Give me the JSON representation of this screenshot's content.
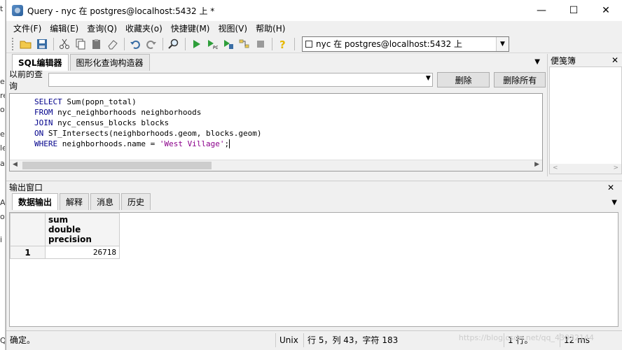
{
  "window": {
    "title": "Query - nyc 在  postgres@localhost:5432 上 *",
    "controls": {
      "minimize": "—",
      "maximize": "☐",
      "close": "✕"
    }
  },
  "menubar": [
    "文件(F)",
    "编辑(E)",
    "查询(Q)",
    "收藏夹(o)",
    "快捷键(M)",
    "视图(V)",
    "帮助(H)"
  ],
  "toolbar": {
    "connection": "nyc 在  postgres@localhost:5432 上"
  },
  "sql_panel": {
    "tabs": [
      "SQL编辑器",
      "图形化查询构造器"
    ],
    "history_label": "以前的查询",
    "delete_button": "删除",
    "delete_all_button": "删除所有",
    "code": {
      "l1a": "SELECT",
      "l1b": " Sum(popn_total)",
      "l2a": "FROM",
      "l2b": " nyc_neighborhoods neighborhoods",
      "l3a": "JOIN",
      "l3b": " nyc_census_blocks blocks",
      "l4a": "ON",
      "l4b": " ST_Intersects(neighborhoods.geom, blocks.geom)",
      "l5a": "WHERE",
      "l5b": " neighborhoods.name = ",
      "l5c": "'West Village'",
      "l5d": ";"
    }
  },
  "notes_panel": {
    "title": "便笺簿",
    "close": "✕"
  },
  "output_panel": {
    "title": "输出窗口",
    "close": "✕",
    "tabs": [
      "数据输出",
      "解释",
      "消息",
      "历史"
    ],
    "column_name": "sum",
    "column_type": "double precision",
    "rows": [
      {
        "num": "1",
        "value": "26718"
      }
    ]
  },
  "statusbar": {
    "status": "确定。",
    "line_ending": "Unix",
    "position": "行 5，列 43，字符 183",
    "rows": "1 行。",
    "time": "12 ms"
  },
  "watermark": "https://blog.csdn.net/qq_43032144"
}
